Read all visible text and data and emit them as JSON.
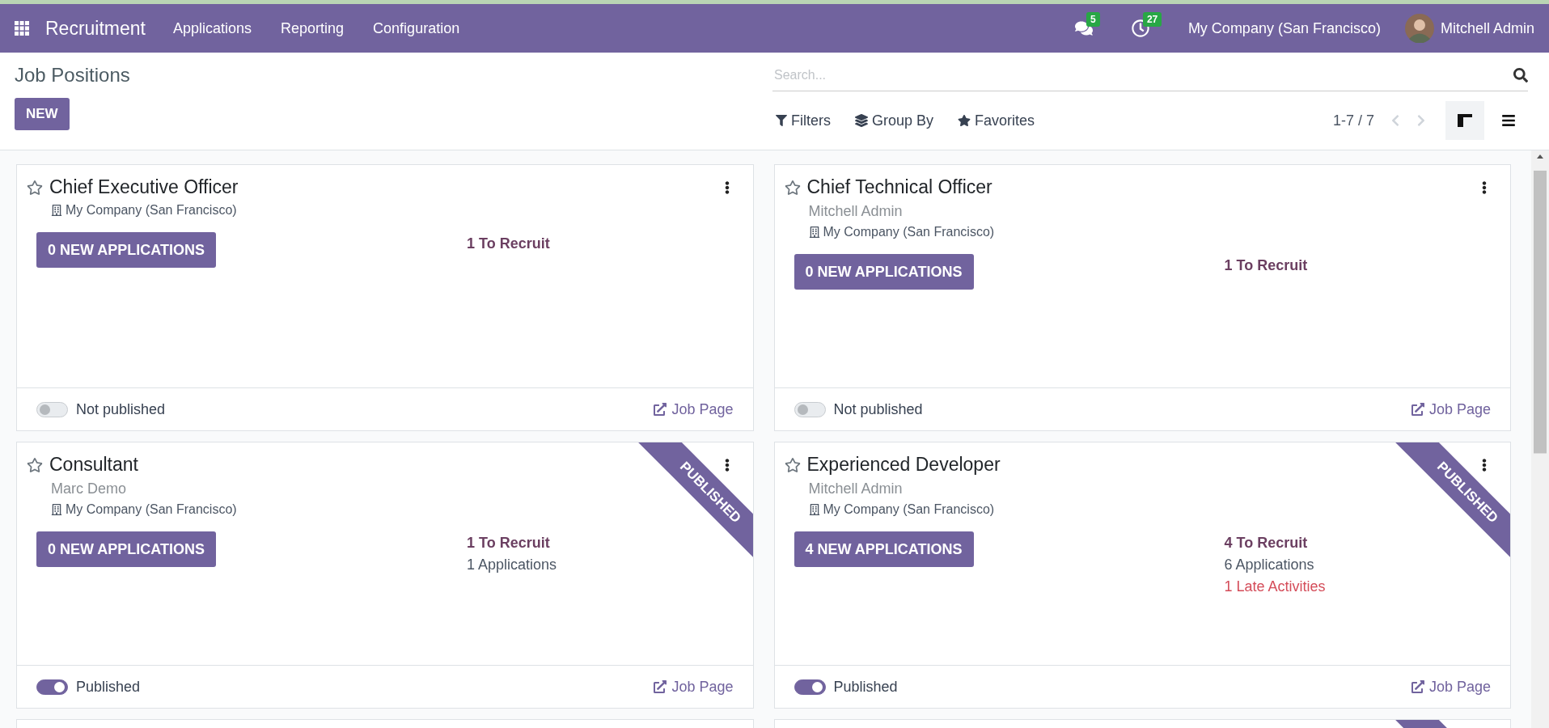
{
  "navbar": {
    "app_name": "Recruitment",
    "menus": [
      "Applications",
      "Reporting",
      "Configuration"
    ],
    "messages_count": "5",
    "activities_count": "27",
    "company": "My Company (San Francisco)",
    "user": "Mitchell Admin"
  },
  "control_panel": {
    "title": "Job Positions",
    "new_button": "NEW",
    "search": {
      "placeholder": "Search..."
    },
    "search_options": [
      {
        "kind": "filter",
        "label": "Filters"
      },
      {
        "kind": "group",
        "label": "Group By"
      },
      {
        "kind": "favorite",
        "label": "Favorites"
      }
    ],
    "pager": "1-7 / 7",
    "views": [
      {
        "kind": "kanban",
        "selected": true
      },
      {
        "kind": "list",
        "selected": false
      }
    ]
  },
  "jobs": [
    {
      "title": "Chief Executive Officer",
      "favorite": false,
      "company": "My Company (San Francisco)",
      "new_applications": "0 NEW APPLICATIONS",
      "stats": [
        {
          "kind": "to_recruit",
          "text": "1 To Recruit"
        }
      ],
      "published": false,
      "publish_label": "Not published",
      "job_page": "Job Page"
    },
    {
      "title": "Chief Technical Officer",
      "favorite": false,
      "manager": "Mitchell Admin",
      "company": "My Company (San Francisco)",
      "new_applications": "0 NEW APPLICATIONS",
      "stats": [
        {
          "kind": "to_recruit",
          "text": "1 To Recruit"
        }
      ],
      "published": false,
      "publish_label": "Not published",
      "job_page": "Job Page"
    },
    {
      "title": "Consultant",
      "favorite": false,
      "manager": "Marc Demo",
      "company": "My Company (San Francisco)",
      "new_applications": "0 NEW APPLICATIONS",
      "stats": [
        {
          "kind": "to_recruit",
          "text": "1 To Recruit"
        },
        {
          "kind": "applications",
          "text": "1 Applications"
        }
      ],
      "published": true,
      "publish_label": "Published",
      "job_page": "Job Page",
      "ribbon": "PUBLISHED"
    },
    {
      "title": "Experienced Developer",
      "favorite": false,
      "manager": "Mitchell Admin",
      "company": "My Company (San Francisco)",
      "new_applications": "4 NEW APPLICATIONS",
      "stats": [
        {
          "kind": "to_recruit",
          "text": "4 To Recruit"
        },
        {
          "kind": "applications",
          "text": "6 Applications"
        },
        {
          "kind": "late",
          "text": "1 Late Activities"
        }
      ],
      "published": true,
      "publish_label": "Published",
      "job_page": "Job Page",
      "ribbon": "PUBLISHED"
    }
  ],
  "clipped_cards": [
    {
      "ribbon": false
    },
    {
      "ribbon": true
    }
  ]
}
